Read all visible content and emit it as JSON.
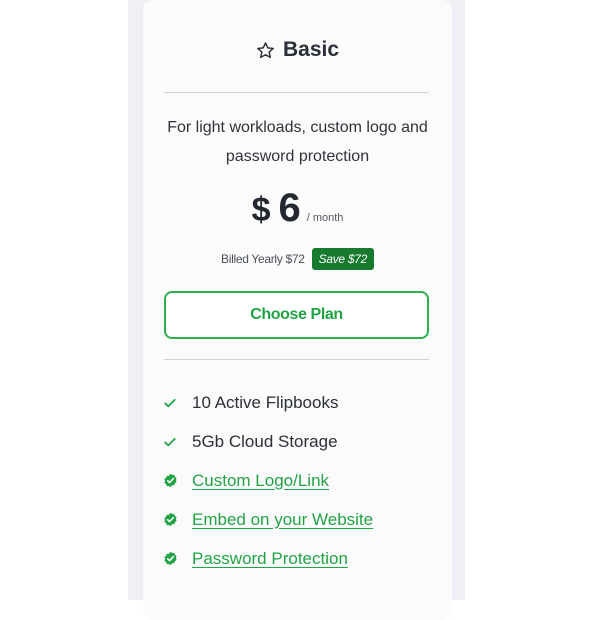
{
  "plan": {
    "icon": "star-outline-icon",
    "name": "Basic",
    "description": "For light workloads, custom logo and password protection",
    "price": {
      "currency": "$",
      "amount": "6",
      "period": "/ month"
    },
    "billing": {
      "text": "Billed Yearly $72",
      "save_badge": "Save $72"
    },
    "cta_label": "Choose Plan",
    "features": [
      {
        "label": "10 Active Flipbooks",
        "icon": "check-icon",
        "link": false
      },
      {
        "label": "5Gb Cloud Storage",
        "icon": "check-icon",
        "link": false
      },
      {
        "label": "Custom Logo/Link",
        "icon": "verified-badge-icon",
        "link": true
      },
      {
        "label": "Embed on your Website",
        "icon": "verified-badge-icon",
        "link": true
      },
      {
        "label": "Password Protection",
        "icon": "verified-badge-icon",
        "link": true
      }
    ]
  },
  "colors": {
    "accent_green": "#22a346",
    "badge_green": "#177a2e",
    "text_dark": "#2b2f38",
    "backdrop": "#eef0f6"
  }
}
